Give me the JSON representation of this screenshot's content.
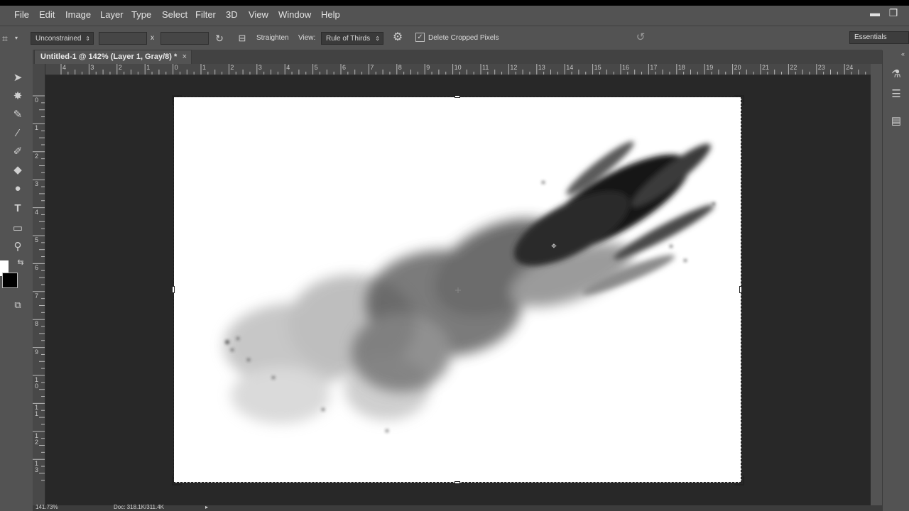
{
  "menu": {
    "items": [
      "File",
      "Edit",
      "Image",
      "Layer",
      "Type",
      "Select",
      "Filter",
      "3D",
      "View",
      "Window",
      "Help"
    ]
  },
  "window_controls": {
    "minimize_icon": "minimize-icon",
    "restore_icon": "restore-icon"
  },
  "options": {
    "preset": "Unconstrained",
    "width_value": "",
    "height_value": "",
    "x_separator": "x",
    "straighten_label": "Straighten",
    "view_label": "View:",
    "view_value": "Rule of Thirds",
    "delete_cropped_label": "Delete Cropped Pixels",
    "delete_cropped_checked": true,
    "workspace": "Essentials"
  },
  "document": {
    "tab_title": "Untitled-1 @ 142% (Layer 1, Gray/8) *",
    "close": "×"
  },
  "rulers": {
    "horizontal": [
      "4",
      "3",
      "2",
      "1",
      "0",
      "1",
      "2",
      "3",
      "4",
      "5",
      "6",
      "7",
      "8",
      "9",
      "10",
      "11",
      "12",
      "13",
      "14",
      "15",
      "16",
      "17",
      "18",
      "19",
      "20",
      "21",
      "22",
      "23",
      "24"
    ],
    "vertical": [
      "0",
      "1",
      "2",
      "3",
      "4",
      "5",
      "6",
      "7",
      "8",
      "9",
      "1\n0",
      "1\n1",
      "1\n2",
      "1\n3"
    ]
  },
  "status": {
    "zoom": "141.73%",
    "doc_size": "Doc: 318.1K/311.4K"
  },
  "colors": {
    "ui_bg": "#535353",
    "canvas_bg": "#282828",
    "foreground_swatch": "#ffffff",
    "background_swatch": "#000000"
  }
}
